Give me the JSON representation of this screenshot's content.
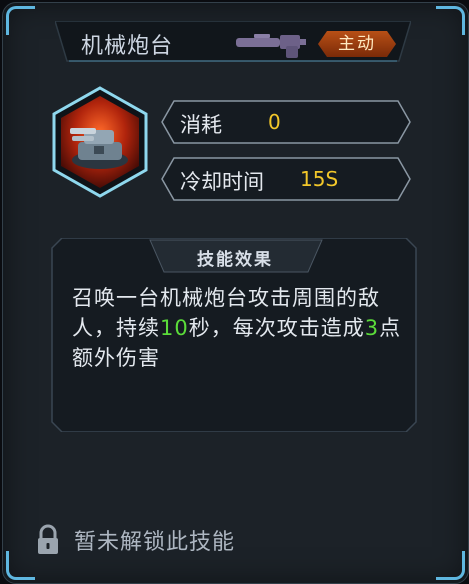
{
  "skill": {
    "name": "机械炮台",
    "weapon_icon": "rifle-icon",
    "type_badge": "主动",
    "icon": "turret-icon"
  },
  "stats": [
    {
      "label": "消耗",
      "value": "0"
    },
    {
      "label": "冷却时间",
      "value": "15S"
    }
  ],
  "effect": {
    "header": "技能效果",
    "text_parts": [
      "召唤一台机械炮台攻击周围的敌人，持续",
      "10",
      "秒，每次攻击造成",
      "3",
      "点额外伤害"
    ]
  },
  "lock": {
    "icon": "lock-icon",
    "text": "暂未解锁此技能"
  },
  "colors": {
    "panel_bg": "#1c2228",
    "accent_blue": "#5fb7e0",
    "value_yellow": "#f2c72a",
    "highlight_green": "#5bdc3a",
    "badge_orange": "#b85016"
  }
}
